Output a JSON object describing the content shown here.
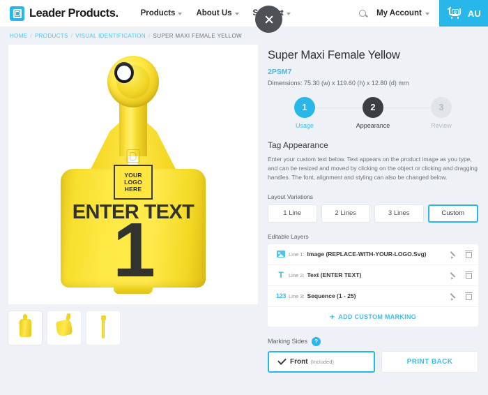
{
  "header": {
    "brand_name": "Leader Products.",
    "brand_icon": "leader-products-logo",
    "nav": [
      {
        "label": "Products",
        "icon": "chevron-down-icon"
      },
      {
        "label": "About Us",
        "icon": "chevron-down-icon"
      },
      {
        "label": "Support",
        "icon": "chevron-down-icon"
      }
    ],
    "search_icon": "search-icon",
    "account_label": "My Account",
    "account_icon": "chevron-down-icon",
    "cart": {
      "icon": "shopping-cart-icon",
      "count": "0",
      "currency_label": "AU"
    },
    "close_icon": "close-icon",
    "accent_color": "#29b6e8"
  },
  "breadcrumb": {
    "items": [
      {
        "label": "HOME",
        "link": true
      },
      {
        "label": "PRODUCTS",
        "link": true
      },
      {
        "label": "VISUAL IDENTIFICATION",
        "link": true
      },
      {
        "label": "SUPER MAXI FEMALE YELLOW",
        "link": false
      }
    ],
    "separator": "/"
  },
  "product_preview": {
    "tag_logo_placeholder": [
      "YOUR",
      "LOGO",
      "HERE"
    ],
    "tag_text": "ENTER TEXT",
    "tag_sequence": "1",
    "tag_color": "#ffe84a",
    "tag_text_color": "#32332c",
    "thumbnails": [
      {
        "name": "thumbnail-front-view",
        "selected": true
      },
      {
        "name": "thumbnail-angle-view",
        "selected": false
      },
      {
        "name": "thumbnail-side-view",
        "selected": false
      }
    ]
  },
  "product": {
    "title": "Super Maxi Female Yellow",
    "sku": "2PSM7",
    "dimensions": "Dimensions: 75.30 (w) x 119.60 (h) x 12.80 (d) mm"
  },
  "stepper": {
    "steps": [
      {
        "number": "1",
        "label": "Usage",
        "state": "done"
      },
      {
        "number": "2",
        "label": "Appearance",
        "state": "active"
      },
      {
        "number": "3",
        "label": "Review",
        "state": "todo"
      }
    ]
  },
  "appearance": {
    "heading": "Tag Appearance",
    "description": "Enter your custom text below. Text appears on the product image as you type, and can be resized and moved by clicking on the object or clicking and dragging handles. The font, alignment and styling can also be changed below."
  },
  "layout_variations": {
    "label": "Layout Variations",
    "options": [
      {
        "label": "1 Line",
        "selected": false
      },
      {
        "label": "2 Lines",
        "selected": false
      },
      {
        "label": "3 Lines",
        "selected": false
      },
      {
        "label": "Custom",
        "selected": true
      }
    ]
  },
  "editable_layers": {
    "label": "Editable Layers",
    "rows": [
      {
        "icon": "image-icon",
        "icon_text": "",
        "prefix": "Line 1:",
        "text": "Image (REPLACE-WITH-YOUR-LOGO.Svg)",
        "edit_icon": "pencil-icon",
        "delete_icon": "trash-icon"
      },
      {
        "icon": "text-icon",
        "icon_text": "T",
        "prefix": "Line 2:",
        "text": "Text (ENTER TEXT)",
        "edit_icon": "pencil-icon",
        "delete_icon": "trash-icon"
      },
      {
        "icon": "sequence-icon",
        "icon_text": "123",
        "prefix": "Line 3:",
        "text": "Sequence (1 - 25)",
        "edit_icon": "pencil-icon",
        "delete_icon": "trash-icon"
      }
    ],
    "add_label": "ADD CUSTOM MARKING",
    "add_icon": "plus-icon"
  },
  "marking_sides": {
    "label": "Marking Sides",
    "help_icon": "?",
    "front": {
      "check_icon": "check-icon",
      "label": "Front",
      "note": "(Included)",
      "selected": true
    },
    "back": {
      "label": "PRINT BACK",
      "selected": false
    }
  }
}
